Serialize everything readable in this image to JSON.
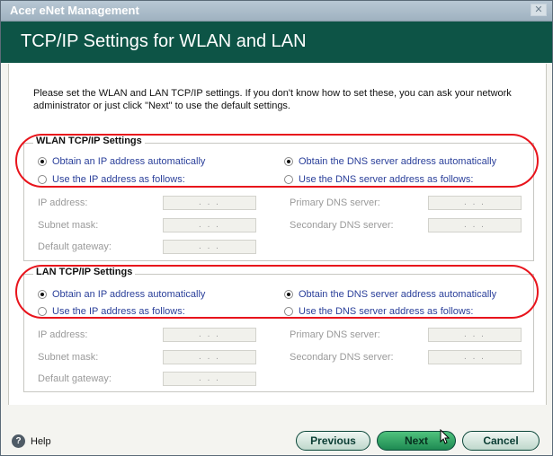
{
  "window": {
    "title": "Acer eNet Management",
    "close_icon": "close-icon"
  },
  "header": {
    "title": "TCP/IP Settings for WLAN and LAN"
  },
  "intro": "Please set the WLAN and LAN TCP/IP settings. If you don't know how to set these, you can ask your network administrator or just click \"Next\" to use the default settings.",
  "wlan": {
    "legend": "WLAN TCP/IP Settings",
    "ip_auto": "Obtain an IP address automatically",
    "ip_manual": "Use the IP address as follows:",
    "dns_auto": "Obtain the DNS server address automatically",
    "dns_manual": "Use the DNS server address as follows:",
    "ip_address_label": "IP address:",
    "subnet_label": "Subnet mask:",
    "gateway_label": "Default gateway:",
    "primary_dns_label": "Primary DNS server:",
    "secondary_dns_label": "Secondary DNS server:",
    "ip_placeholder": ". . ."
  },
  "lan": {
    "legend": "LAN TCP/IP Settings",
    "ip_auto": "Obtain an IP address automatically",
    "ip_manual": "Use the IP address as follows:",
    "dns_auto": "Obtain the DNS server address automatically",
    "dns_manual": "Use the DNS server address as follows:",
    "ip_address_label": "IP address:",
    "subnet_label": "Subnet mask:",
    "gateway_label": "Default gateway:",
    "primary_dns_label": "Primary DNS server:",
    "secondary_dns_label": "Secondary DNS server:",
    "ip_placeholder": ". . ."
  },
  "footer": {
    "help": "Help",
    "previous": "Previous",
    "next": "Next",
    "cancel": "Cancel"
  },
  "colors": {
    "header_bg": "#0d5446",
    "radio_text": "#2a3f9a",
    "highlight_oval": "#e8141c"
  }
}
